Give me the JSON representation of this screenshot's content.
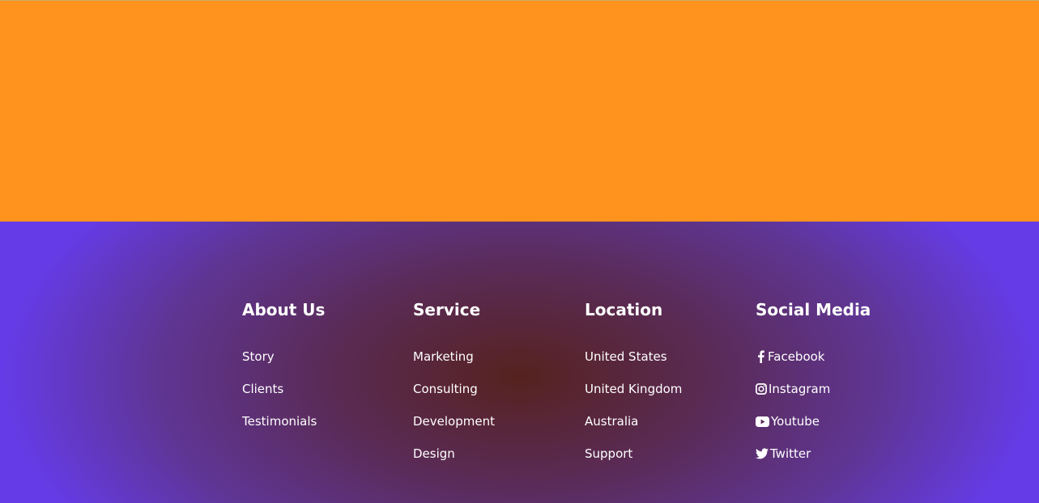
{
  "colors": {
    "hero_background": "#ff931e",
    "footer_edge": "#653be8",
    "footer_center": "#56221f",
    "text": "#ffffff"
  },
  "footer": {
    "columns": [
      {
        "heading": "About Us",
        "links": [
          "Story",
          "Clients",
          "Testimonials"
        ]
      },
      {
        "heading": "Service",
        "links": [
          "Marketing",
          "Consulting",
          "Development",
          "Design"
        ]
      },
      {
        "heading": "Location",
        "links": [
          "United States",
          "United Kingdom",
          "Australia",
          "Support"
        ]
      },
      {
        "heading": "Social Media",
        "links": [
          {
            "icon": "facebook-icon",
            "label": "Facebook"
          },
          {
            "icon": "instagram-icon",
            "label": "Instagram"
          },
          {
            "icon": "youtube-icon",
            "label": "Youtube"
          },
          {
            "icon": "twitter-icon",
            "label": "Twitter"
          }
        ]
      }
    ]
  }
}
